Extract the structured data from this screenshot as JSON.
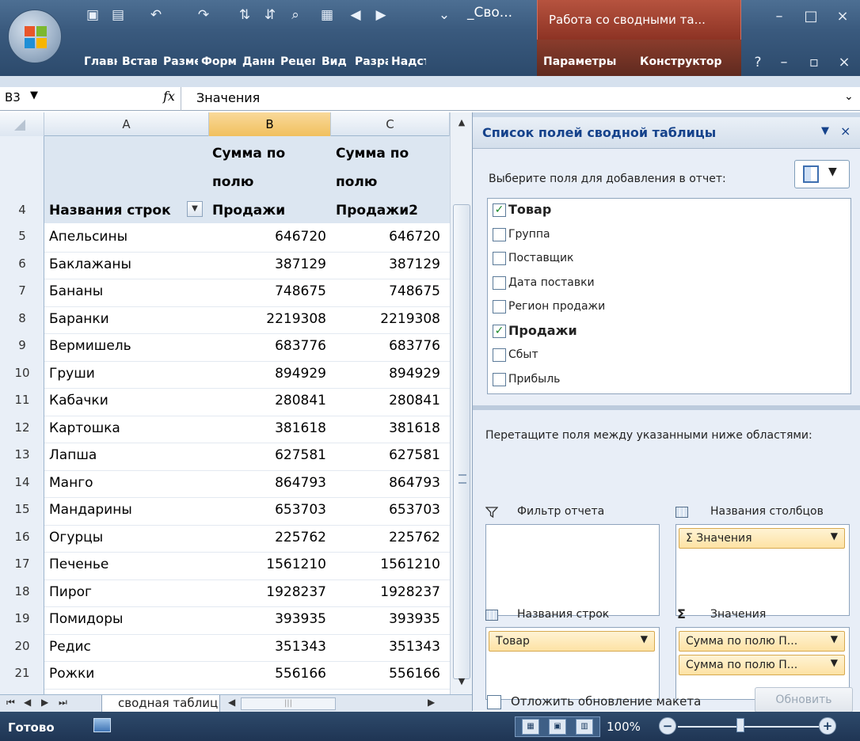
{
  "window": {
    "title": "_Сво...",
    "context_tab": "Работа со сводными та..."
  },
  "ribbon_tabs": [
    "Главн",
    "Встав",
    "Разме",
    "Форм",
    "Данн",
    "Рецег",
    "Вид",
    "Разра",
    "Надст",
    "Параметры",
    "Конструктор"
  ],
  "formula_bar": {
    "cell_ref": "B3",
    "fx": "fx",
    "value": "Значения"
  },
  "sheet": {
    "columns": [
      "A",
      "B",
      "C"
    ],
    "selected_column": "B",
    "header_row_number": "4",
    "header": {
      "a": "Названия строк",
      "b_lines": [
        "Сумма по",
        "полю",
        "Продажи"
      ],
      "c_lines": [
        "Сумма по",
        "полю",
        "Продажи2"
      ]
    },
    "rows": [
      {
        "n": "5",
        "name": "Апельсины",
        "b": "646720",
        "c": "646720"
      },
      {
        "n": "6",
        "name": "Баклажаны",
        "b": "387129",
        "c": "387129"
      },
      {
        "n": "7",
        "name": "Бананы",
        "b": "748675",
        "c": "748675"
      },
      {
        "n": "8",
        "name": "Баранки",
        "b": "2219308",
        "c": "2219308"
      },
      {
        "n": "9",
        "name": "Вермишель",
        "b": "683776",
        "c": "683776"
      },
      {
        "n": "10",
        "name": "Груши",
        "b": "894929",
        "c": "894929"
      },
      {
        "n": "11",
        "name": "Кабачки",
        "b": "280841",
        "c": "280841"
      },
      {
        "n": "12",
        "name": "Картошка",
        "b": "381618",
        "c": "381618"
      },
      {
        "n": "13",
        "name": "Лапша",
        "b": "627581",
        "c": "627581"
      },
      {
        "n": "14",
        "name": "Манго",
        "b": "864793",
        "c": "864793"
      },
      {
        "n": "15",
        "name": "Мандарины",
        "b": "653703",
        "c": "653703"
      },
      {
        "n": "16",
        "name": "Огурцы",
        "b": "225762",
        "c": "225762"
      },
      {
        "n": "17",
        "name": "Печенье",
        "b": "1561210",
        "c": "1561210"
      },
      {
        "n": "18",
        "name": "Пирог",
        "b": "1928237",
        "c": "1928237"
      },
      {
        "n": "19",
        "name": "Помидоры",
        "b": "393935",
        "c": "393935"
      },
      {
        "n": "20",
        "name": "Редис",
        "b": "351343",
        "c": "351343"
      },
      {
        "n": "21",
        "name": "Рожки",
        "b": "556166",
        "c": "556166"
      }
    ],
    "sheet_tab": "сводная таблиц"
  },
  "field_pane": {
    "title": "Список полей сводной таблицы",
    "choose_label": "Выберите поля для добавления в отчет:",
    "fields": [
      {
        "label": "Товар",
        "checked": true
      },
      {
        "label": "Группа",
        "checked": false
      },
      {
        "label": "Поставщик",
        "checked": false
      },
      {
        "label": "Дата поставки",
        "checked": false
      },
      {
        "label": "Регион продажи",
        "checked": false
      },
      {
        "label": "Продажи",
        "checked": true
      },
      {
        "label": "Сбыт",
        "checked": false
      },
      {
        "label": "Прибыль",
        "checked": false
      }
    ],
    "drag_label": "Перетащите поля между указанными ниже областями:",
    "areas": {
      "filter": "Фильтр отчета",
      "columns": "Названия столбцов",
      "rows": "Названия строк",
      "values": "Значения"
    },
    "column_chip": "Σ  Значения",
    "row_chip": "Товар",
    "value_chips": [
      "Сумма по полю П...",
      "Сумма по полю П..."
    ],
    "defer_label": "Отложить обновление макета",
    "update_button": "Обновить"
  },
  "statusbar": {
    "status": "Готово",
    "zoom": "100%"
  },
  "icons": {
    "check": "✓",
    "dropdown": "▼",
    "sigma": "Σ",
    "filter": "funnel-icon"
  }
}
